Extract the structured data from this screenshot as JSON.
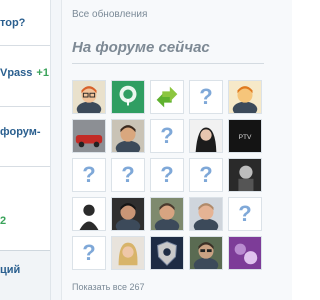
{
  "sidebar": {
    "fragments": [
      {
        "text": "тор?",
        "extra": ""
      },
      {
        "text": "Vpass",
        "extra": "+1"
      },
      {
        "text": "форум-",
        "extra": ""
      },
      {
        "text": "2",
        "extra": ""
      }
    ],
    "footer_text": "ций"
  },
  "header": {
    "all_updates_label": "Все обновления"
  },
  "forum": {
    "title": "На форуме сейчас",
    "show_all_label": "Показать все 267",
    "avatars": [
      {
        "type": "photo",
        "name": "user-avatar-cartoon-glasses"
      },
      {
        "type": "logo",
        "name": "user-avatar-green-tree-logo"
      },
      {
        "type": "logo",
        "name": "user-avatar-green-arrows"
      },
      {
        "type": "placeholder",
        "name": "user-avatar-placeholder"
      },
      {
        "type": "photo",
        "name": "user-avatar-cartoon-face"
      },
      {
        "type": "photo",
        "name": "user-avatar-red-car"
      },
      {
        "type": "photo",
        "name": "user-avatar-man-portrait"
      },
      {
        "type": "placeholder",
        "name": "user-avatar-placeholder"
      },
      {
        "type": "photo",
        "name": "user-avatar-woman-portrait"
      },
      {
        "type": "logo",
        "name": "user-avatar-dark-logo",
        "text": "PTV"
      },
      {
        "type": "placeholder",
        "name": "user-avatar-placeholder"
      },
      {
        "type": "placeholder",
        "name": "user-avatar-placeholder"
      },
      {
        "type": "placeholder",
        "name": "user-avatar-placeholder"
      },
      {
        "type": "placeholder",
        "name": "user-avatar-placeholder"
      },
      {
        "type": "photo",
        "name": "user-avatar-dark-figure"
      },
      {
        "type": "photo",
        "name": "user-avatar-silhouette"
      },
      {
        "type": "photo",
        "name": "user-avatar-man-dark"
      },
      {
        "type": "photo",
        "name": "user-avatar-man-suit"
      },
      {
        "type": "photo",
        "name": "user-avatar-man-face"
      },
      {
        "type": "placeholder",
        "name": "user-avatar-placeholder"
      },
      {
        "type": "placeholder",
        "name": "user-avatar-placeholder"
      },
      {
        "type": "photo",
        "name": "user-avatar-woman-blonde"
      },
      {
        "type": "logo",
        "name": "user-avatar-shield-emblem"
      },
      {
        "type": "photo",
        "name": "user-avatar-man-glasses"
      },
      {
        "type": "logo",
        "name": "user-avatar-purple-graphic"
      }
    ]
  },
  "colors": {
    "accent": "#2a5f8f",
    "placeholder_q": "#7fa8d8",
    "muted_text": "#7b8a97"
  }
}
